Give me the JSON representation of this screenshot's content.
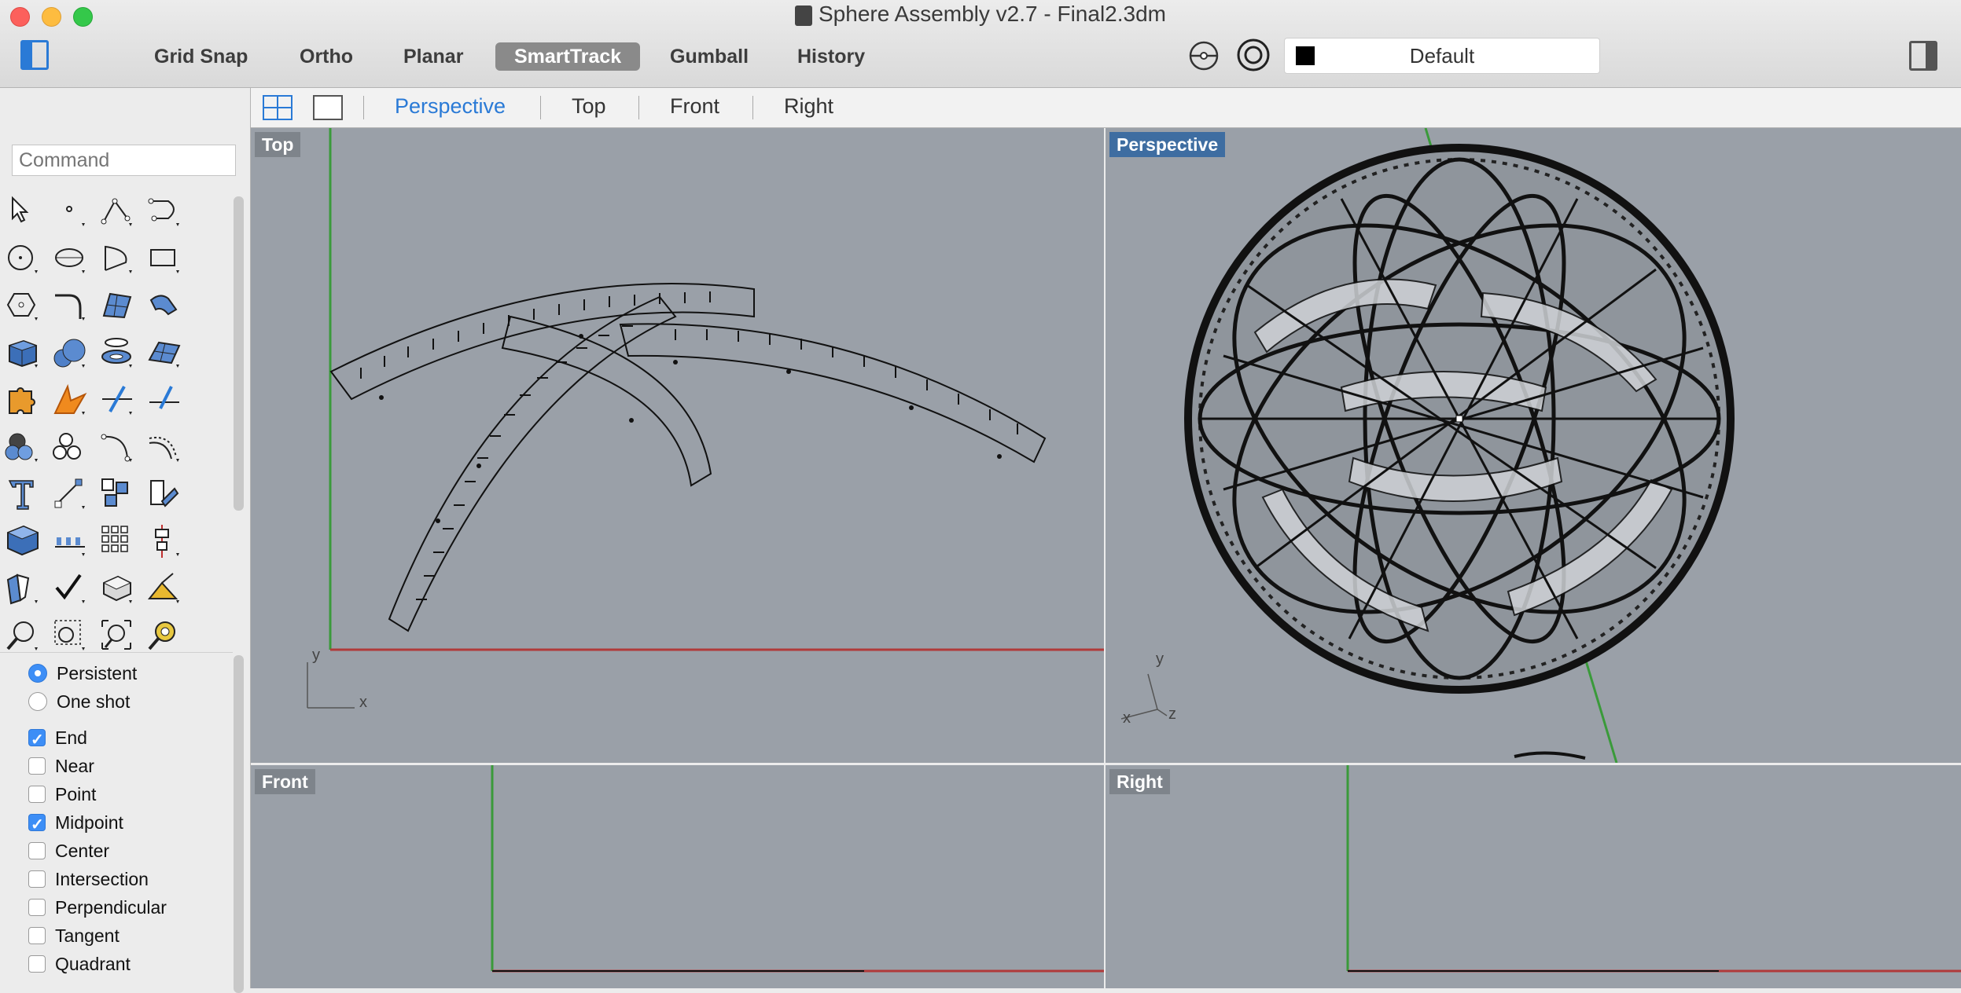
{
  "window": {
    "title": "Sphere Assembly v2.7 - Final2.3dm"
  },
  "toolbar": {
    "buttons": [
      {
        "label": "Grid Snap"
      },
      {
        "label": "Ortho"
      },
      {
        "label": "Planar"
      },
      {
        "label": "SmartTrack",
        "active": true
      },
      {
        "label": "Gumball"
      },
      {
        "label": "History"
      }
    ],
    "layer": {
      "name": "Default",
      "color": "#000000"
    }
  },
  "sidebar": {
    "command_placeholder": "Command",
    "osnap_mode": [
      {
        "label": "Persistent",
        "checked": true
      },
      {
        "label": "One shot",
        "checked": false
      }
    ],
    "osnaps": [
      {
        "label": "End",
        "checked": true
      },
      {
        "label": "Near",
        "checked": false
      },
      {
        "label": "Point",
        "checked": false
      },
      {
        "label": "Midpoint",
        "checked": true
      },
      {
        "label": "Center",
        "checked": false
      },
      {
        "label": "Intersection",
        "checked": false
      },
      {
        "label": "Perpendicular",
        "checked": false
      },
      {
        "label": "Tangent",
        "checked": false
      },
      {
        "label": "Quadrant",
        "checked": false
      }
    ]
  },
  "viewport_tabs": [
    {
      "label": "Perspective",
      "active": true
    },
    {
      "label": "Top"
    },
    {
      "label": "Front"
    },
    {
      "label": "Right"
    }
  ],
  "viewports": {
    "top": {
      "label": "Top",
      "axis_x": "x",
      "axis_y": "y"
    },
    "perspective": {
      "label": "Perspective",
      "axis_x": "x",
      "axis_y": "y",
      "axis_z": "z"
    },
    "front": {
      "label": "Front"
    },
    "right": {
      "label": "Right"
    }
  },
  "colors": {
    "accent": "#2a7ad6",
    "viewport_bg": "#9aa0a8",
    "x_axis": "#b03a3a",
    "y_axis": "#3a9a3a"
  }
}
